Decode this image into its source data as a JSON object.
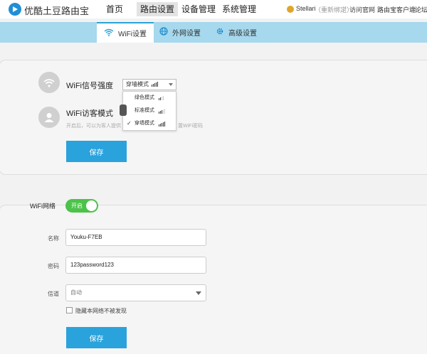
{
  "header": {
    "brand": "优酷土豆路由宝",
    "nav": [
      "首页",
      "路由设置",
      "设备管理",
      "系统管理"
    ],
    "active_nav": 1,
    "user": {
      "name": "Stellari",
      "rebind": "（重新绑定）",
      "links": [
        "访问官网",
        "路由宝客户端",
        "论坛"
      ]
    }
  },
  "subnav": {
    "tabs": [
      {
        "label": "WiFi设置",
        "icon": "wifi-icon",
        "active": true
      },
      {
        "label": "外网设置",
        "icon": "globe-icon",
        "active": false
      },
      {
        "label": "高级设置",
        "icon": "gear-icon",
        "active": false
      }
    ]
  },
  "signal": {
    "label": "WiFi信号强度",
    "selected": "穿墙模式",
    "options": [
      {
        "label": "绿色模式",
        "bars": 2,
        "checked": false
      },
      {
        "label": "标准模式",
        "bars": 3,
        "checked": false
      },
      {
        "label": "穿墙模式",
        "bars": 5,
        "checked": true
      }
    ]
  },
  "guest": {
    "label": "WiFi访客模式",
    "hint_left": "开启后，可以为客人提供",
    "hint_right": "置WiFi密码"
  },
  "buttons": {
    "save": "保存"
  },
  "wifi_network": {
    "label": "WiFi网络",
    "switch_label": "开启",
    "switch_on": true,
    "fields": {
      "name_label": "名称",
      "name_value": "Youku-F7EB",
      "password_label": "密码",
      "password_value": "123password123",
      "channel_label": "信道",
      "channel_value": "自动"
    },
    "hide_ssid_label": "隐藏本网络不被发现",
    "hide_ssid_checked": false
  },
  "colors": {
    "accent": "#2aa2dc",
    "subnav_bg": "#a6d8ee",
    "switch_on": "#4cc24a"
  }
}
